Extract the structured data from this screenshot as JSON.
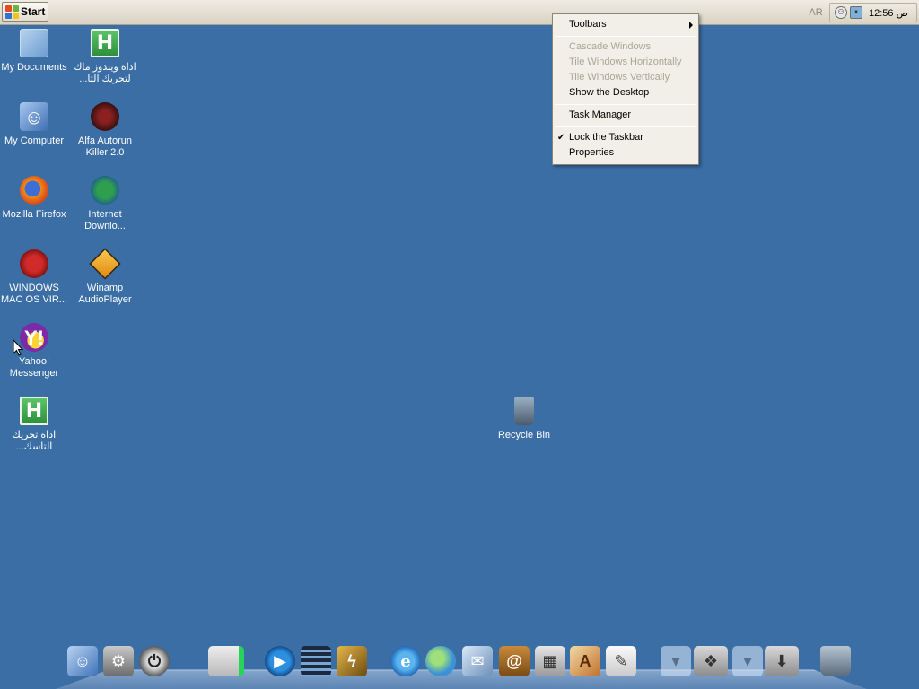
{
  "taskbar": {
    "start_label": "Start",
    "lang_indicator": "AR",
    "clock": "ص 12:56",
    "tray_icons": [
      "smiley-icon",
      "network-icon"
    ]
  },
  "desktop_icons": [
    {
      "name": "my-documents",
      "label1": "My Documents",
      "label2": "",
      "icon": "folder-documents-icon"
    },
    {
      "name": "tool-arabic-1",
      "label1": "اداه ويندوز ماك",
      "label2": "...لتحريك التا",
      "icon": "h-green-icon"
    },
    {
      "name": "my-computer",
      "label1": "My Computer",
      "label2": "",
      "icon": "mac-finder-icon"
    },
    {
      "name": "alfa-autorun",
      "label1": "Alfa Autorun",
      "label2": "Killer 2.0",
      "icon": "killer-icon"
    },
    {
      "name": "mozilla-firefox",
      "label1": "Mozilla Firefox",
      "label2": "",
      "icon": "firefox-icon"
    },
    {
      "name": "internet-download",
      "label1": "Internet",
      "label2": "Downlo...",
      "icon": "idm-icon"
    },
    {
      "name": "windows-mac-os",
      "label1": "WINDOWS",
      "label2": "MAC OS VIR...",
      "icon": "virus-icon"
    },
    {
      "name": "winamp",
      "label1": "Winamp",
      "label2": "AudioPlayer",
      "icon": "winamp-icon"
    },
    {
      "name": "yahoo-messenger",
      "label1": "Yahoo!",
      "label2": "Messenger",
      "icon": "yahoo-icon"
    },
    {
      "name": "tool-arabic-2",
      "label1": "اداه تحريك",
      "label2": "...التاسك",
      "icon": "h-green-icon"
    },
    {
      "name": "recycle-bin",
      "label1": "Recycle Bin",
      "label2": "",
      "icon": "recycle-bin-icon"
    }
  ],
  "context_menu": {
    "items": [
      {
        "label": "Toolbars",
        "disabled": false,
        "submenu": true
      },
      {
        "label": "Cascade Windows",
        "disabled": true
      },
      {
        "label": "Tile Windows Horizontally",
        "disabled": true
      },
      {
        "label": "Tile Windows Vertically",
        "disabled": true
      },
      {
        "label": "Show the Desktop",
        "disabled": false
      },
      {
        "label": "Task Manager",
        "disabled": false
      },
      {
        "label": "Lock the Taskbar",
        "disabled": false,
        "checked": true
      },
      {
        "label": "Properties",
        "disabled": false
      }
    ]
  },
  "dock": {
    "items": [
      "finder-icon",
      "system-preferences-icon",
      "power-icon",
      "drive-icon",
      "quicktime-icon",
      "film-icon",
      "winamp-icon",
      "internet-explorer-icon",
      "messenger-icon",
      "mail-icon",
      "address-book-icon",
      "calculator-icon",
      "app-store-icon",
      "notes-icon",
      "stack-icon",
      "folder-apps-icon",
      "stack-icon",
      "downloads-icon",
      "trash-icon"
    ]
  },
  "colors": {
    "desktop": "#3b6ea5",
    "taskbar": "#ece9d8",
    "menu": "#f1efe7",
    "disabled_text": "#a9a696"
  }
}
